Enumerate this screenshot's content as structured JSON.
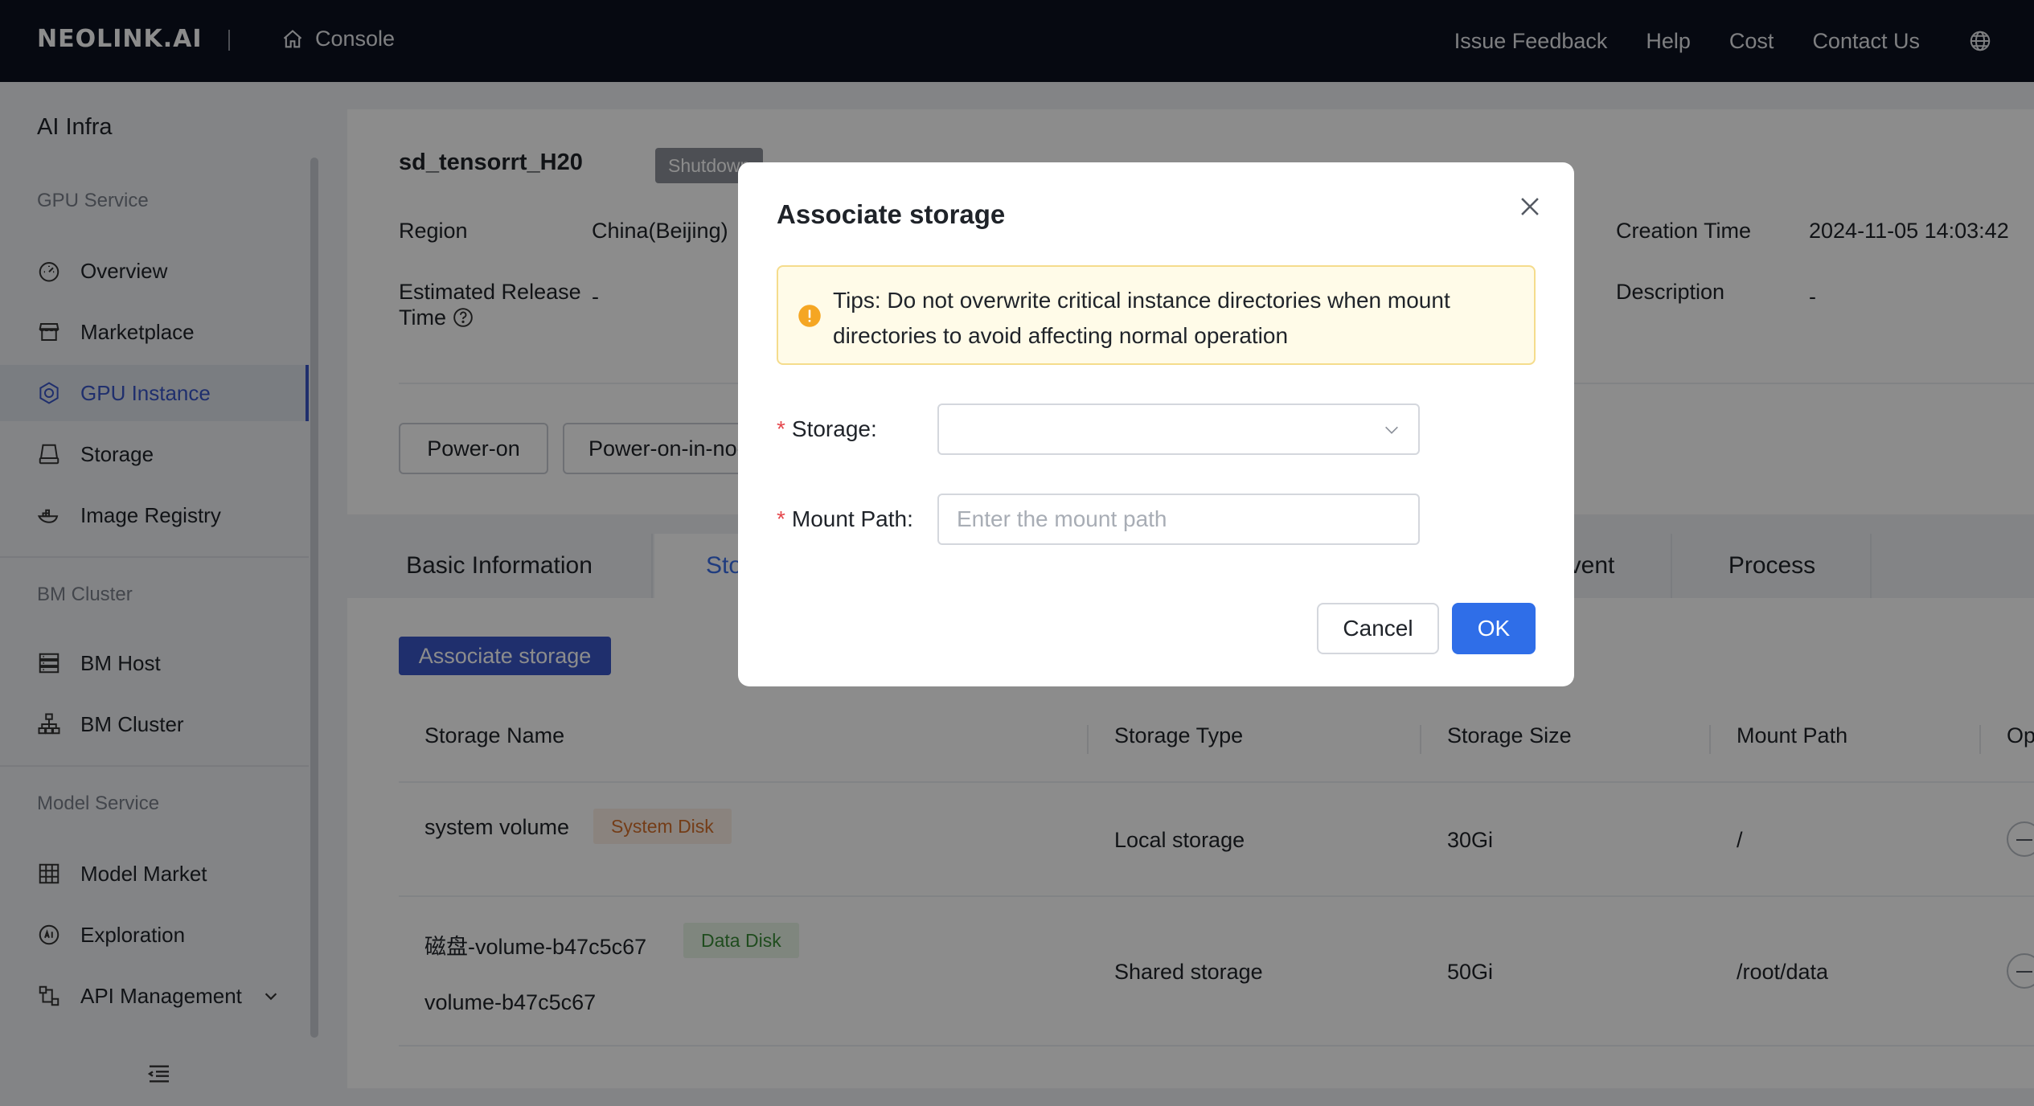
{
  "topbar": {
    "logo": "NEOLINK.AI",
    "console_label": "Console",
    "nav": [
      "Issue Feedback",
      "Help",
      "Cost",
      "Contact Us"
    ]
  },
  "sidebar": {
    "title": "AI Infra",
    "groups": {
      "gpu_service": "GPU Service",
      "bm_cluster": "BM Cluster",
      "model_service": "Model Service"
    },
    "items": {
      "overview": "Overview",
      "marketplace": "Marketplace",
      "gpu_instance": "GPU Instance",
      "storage": "Storage",
      "image_registry": "Image Registry",
      "bm_host": "BM Host",
      "bm_cluster": "BM Cluster",
      "model_market": "Model Market",
      "exploration": "Exploration",
      "api_management": "API Management"
    },
    "active": "gpu_instance"
  },
  "instance": {
    "name": "sd_tensorrt_H20",
    "status": "Shutdown",
    "region_label": "Region",
    "region_value": "China(Beijing)",
    "release_label_1": "Estimated Release",
    "release_label_2": "Time",
    "release_value": "-",
    "creation_label": "Creation Time",
    "creation_value": "2024-11-05 14:03:42",
    "description_label": "Description",
    "description_value": "-",
    "actions": [
      "Power-on",
      "Power-on-in-no-card-mode"
    ]
  },
  "tabs": {
    "basic": "Basic Information",
    "storage": "Storage",
    "event": "Event",
    "process": "Process"
  },
  "storage_table": {
    "associate_label": "Associate storage",
    "columns": [
      "Storage Name",
      "Storage Type",
      "Storage Size",
      "Mount Path",
      "Operation"
    ],
    "rows": [
      {
        "name": "system volume",
        "tag": "System Disk",
        "type": "Local storage",
        "size": "30Gi",
        "path": "/"
      },
      {
        "name": "磁盘-volume-b47c5c67",
        "name2": "volume-b47c5c67",
        "tag": "Data Disk",
        "type": "Shared storage",
        "size": "50Gi",
        "path": "/root/data"
      }
    ]
  },
  "modal": {
    "title": "Associate storage",
    "tips": "Tips: Do not overwrite critical instance directories when mount directories to avoid affecting normal operation",
    "storage_label": "Storage",
    "mount_label": "Mount Path",
    "label_suffix": ":",
    "mount_placeholder": "Enter the mount path",
    "cancel": "Cancel",
    "ok": "OK"
  },
  "colors": {
    "primary": "#2f6ee8",
    "sidebar_active": "#3a56c7",
    "warning": "#f5a623",
    "topbar": "#0c1120"
  }
}
